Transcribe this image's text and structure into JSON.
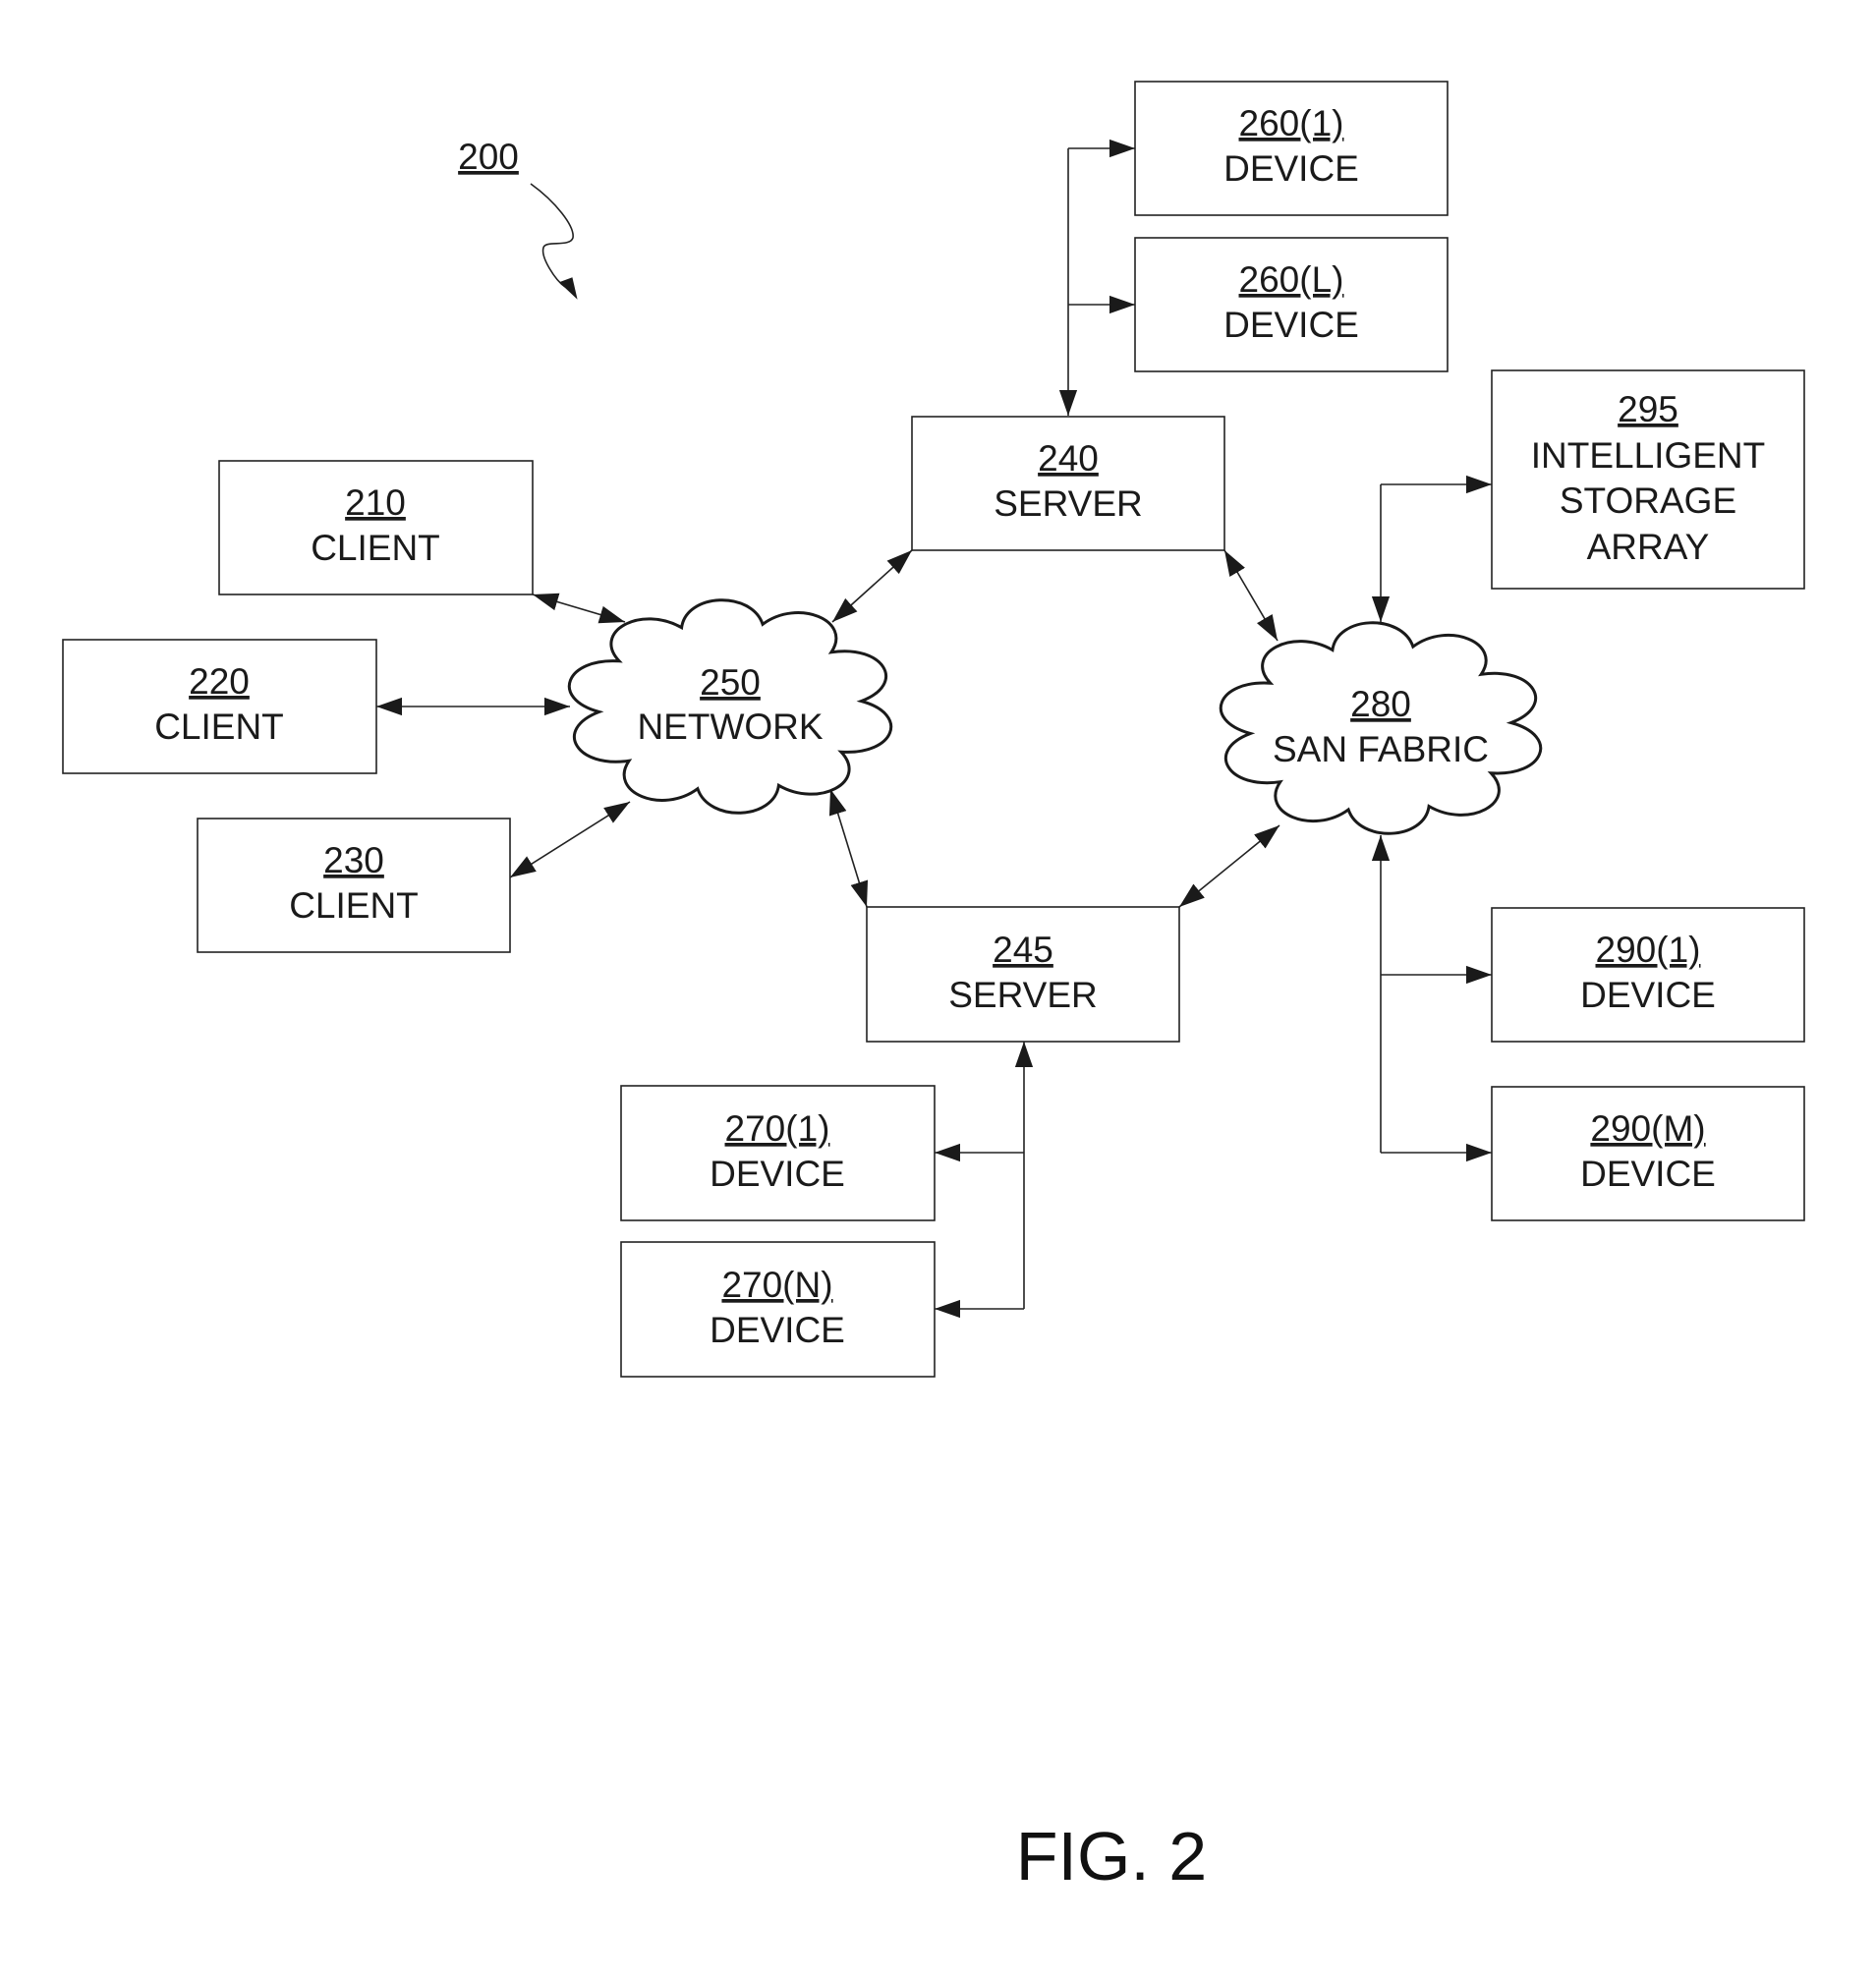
{
  "figure": {
    "reference": "200",
    "caption": "FIG. 2"
  },
  "nodes": {
    "client_210": {
      "ref": "210",
      "label": "CLIENT"
    },
    "client_220": {
      "ref": "220",
      "label": "CLIENT"
    },
    "client_230": {
      "ref": "230",
      "label": "CLIENT"
    },
    "server_240": {
      "ref": "240",
      "label": "SERVER"
    },
    "server_245": {
      "ref": "245",
      "label": "SERVER"
    },
    "network_250": {
      "ref": "250",
      "label": "NETWORK"
    },
    "device_260_1": {
      "ref": "260(1)",
      "label": "DEVICE"
    },
    "device_260_L": {
      "ref": "260(L)",
      "label": "DEVICE"
    },
    "device_270_1": {
      "ref": "270(1)",
      "label": "DEVICE"
    },
    "device_270_N": {
      "ref": "270(N)",
      "label": "DEVICE"
    },
    "san_280": {
      "ref": "280",
      "label": "SAN FABRIC"
    },
    "device_290_1": {
      "ref": "290(1)",
      "label": "DEVICE"
    },
    "device_290_M": {
      "ref": "290(M)",
      "label": "DEVICE"
    },
    "storage_295": {
      "ref": "295",
      "label_lines": [
        "INTELLIGENT",
        "STORAGE",
        "ARRAY"
      ]
    }
  },
  "connections": [
    {
      "from": "210",
      "to": "250",
      "type": "bidirectional"
    },
    {
      "from": "220",
      "to": "250",
      "type": "bidirectional"
    },
    {
      "from": "230",
      "to": "250",
      "type": "bidirectional"
    },
    {
      "from": "240",
      "to": "250",
      "type": "bidirectional"
    },
    {
      "from": "245",
      "to": "250",
      "type": "bidirectional"
    },
    {
      "from": "240",
      "to": "280",
      "type": "bidirectional"
    },
    {
      "from": "245",
      "to": "280",
      "type": "bidirectional"
    },
    {
      "from": "240",
      "to": "260(1)",
      "type": "bus"
    },
    {
      "from": "240",
      "to": "260(L)",
      "type": "bus"
    },
    {
      "from": "245",
      "to": "270(1)",
      "type": "bus"
    },
    {
      "from": "245",
      "to": "270(N)",
      "type": "bus"
    },
    {
      "from": "280",
      "to": "295",
      "type": "bus"
    },
    {
      "from": "280",
      "to": "290(1)",
      "type": "bus"
    },
    {
      "from": "280",
      "to": "290(M)",
      "type": "bus"
    }
  ]
}
